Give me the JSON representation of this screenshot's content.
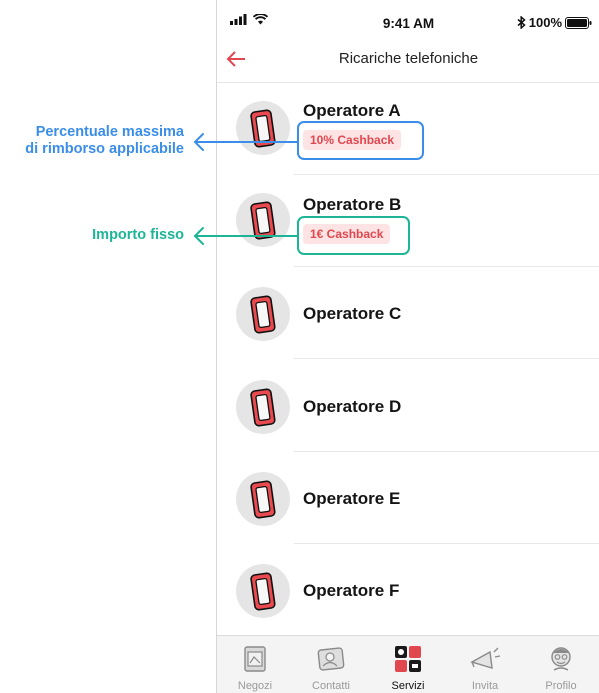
{
  "status_bar": {
    "time": "9:41 AM",
    "battery": "100%",
    "signal_icon": "signal-bars-icon",
    "wifi_icon": "wifi-icon",
    "bluetooth_icon": "bluetooth-icon",
    "battery_icon": "battery-icon"
  },
  "nav": {
    "title": "Ricariche telefoniche",
    "back_icon": "arrow-left-icon"
  },
  "operators": [
    {
      "name": "Operatore A",
      "badge": "10% Cashback",
      "icon": "phone-icon"
    },
    {
      "name": "Operatore B",
      "badge": "1€ Cashback",
      "icon": "phone-icon"
    },
    {
      "name": "Operatore C",
      "icon": "phone-icon"
    },
    {
      "name": "Operatore D",
      "icon": "phone-icon"
    },
    {
      "name": "Operatore E",
      "icon": "phone-icon"
    },
    {
      "name": "Operatore F",
      "icon": "phone-icon"
    }
  ],
  "tabs": [
    {
      "label": "Negozi",
      "icon": "store-icon"
    },
    {
      "label": "Contatti",
      "icon": "contacts-icon"
    },
    {
      "label": "Servizi",
      "icon": "services-icon",
      "active": true
    },
    {
      "label": "Invita",
      "icon": "megaphone-icon"
    },
    {
      "label": "Profilo",
      "icon": "profile-icon"
    }
  ],
  "annotations": {
    "cashback_percent": "Percentuale massima\ndi rimborso applicabile",
    "cashback_fixed": "Importo fisso"
  },
  "colors": {
    "accent_red": "#e0474f",
    "badge_bg": "#fde3e3",
    "annotation_blue": "#3b8ee8",
    "annotation_green": "#1db596"
  }
}
